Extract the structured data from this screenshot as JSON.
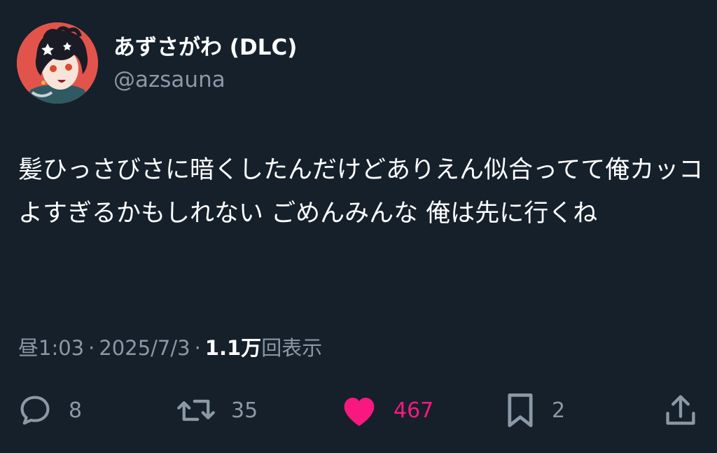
{
  "tweet": {
    "author": {
      "display_name": "あずさがわ (DLC)",
      "handle": "@azsauna"
    },
    "text": "髪ひっさびさに暗くしたんだけどありえん似合ってて俺カッコよすぎるかもしれない ごめんみんな 俺は先に行くね",
    "meta": {
      "time": "昼1:03",
      "separator": "·",
      "date": "2025/7/3",
      "views_count": "1.1万",
      "views_label": "回表示"
    },
    "actions": {
      "replies": "8",
      "retweets": "35",
      "likes": "467",
      "bookmarks": "2"
    }
  },
  "colors": {
    "background": "#15202b",
    "text_primary": "#ffffff",
    "text_secondary": "#8b98a5",
    "like_active": "#f91880",
    "avatar_bg": "#e2544b"
  },
  "icons": {
    "reply": "speech-bubble-icon",
    "retweet": "retweet-arrows-icon",
    "like": "heart-icon",
    "bookmark": "bookmark-icon",
    "share": "share-upload-icon"
  }
}
